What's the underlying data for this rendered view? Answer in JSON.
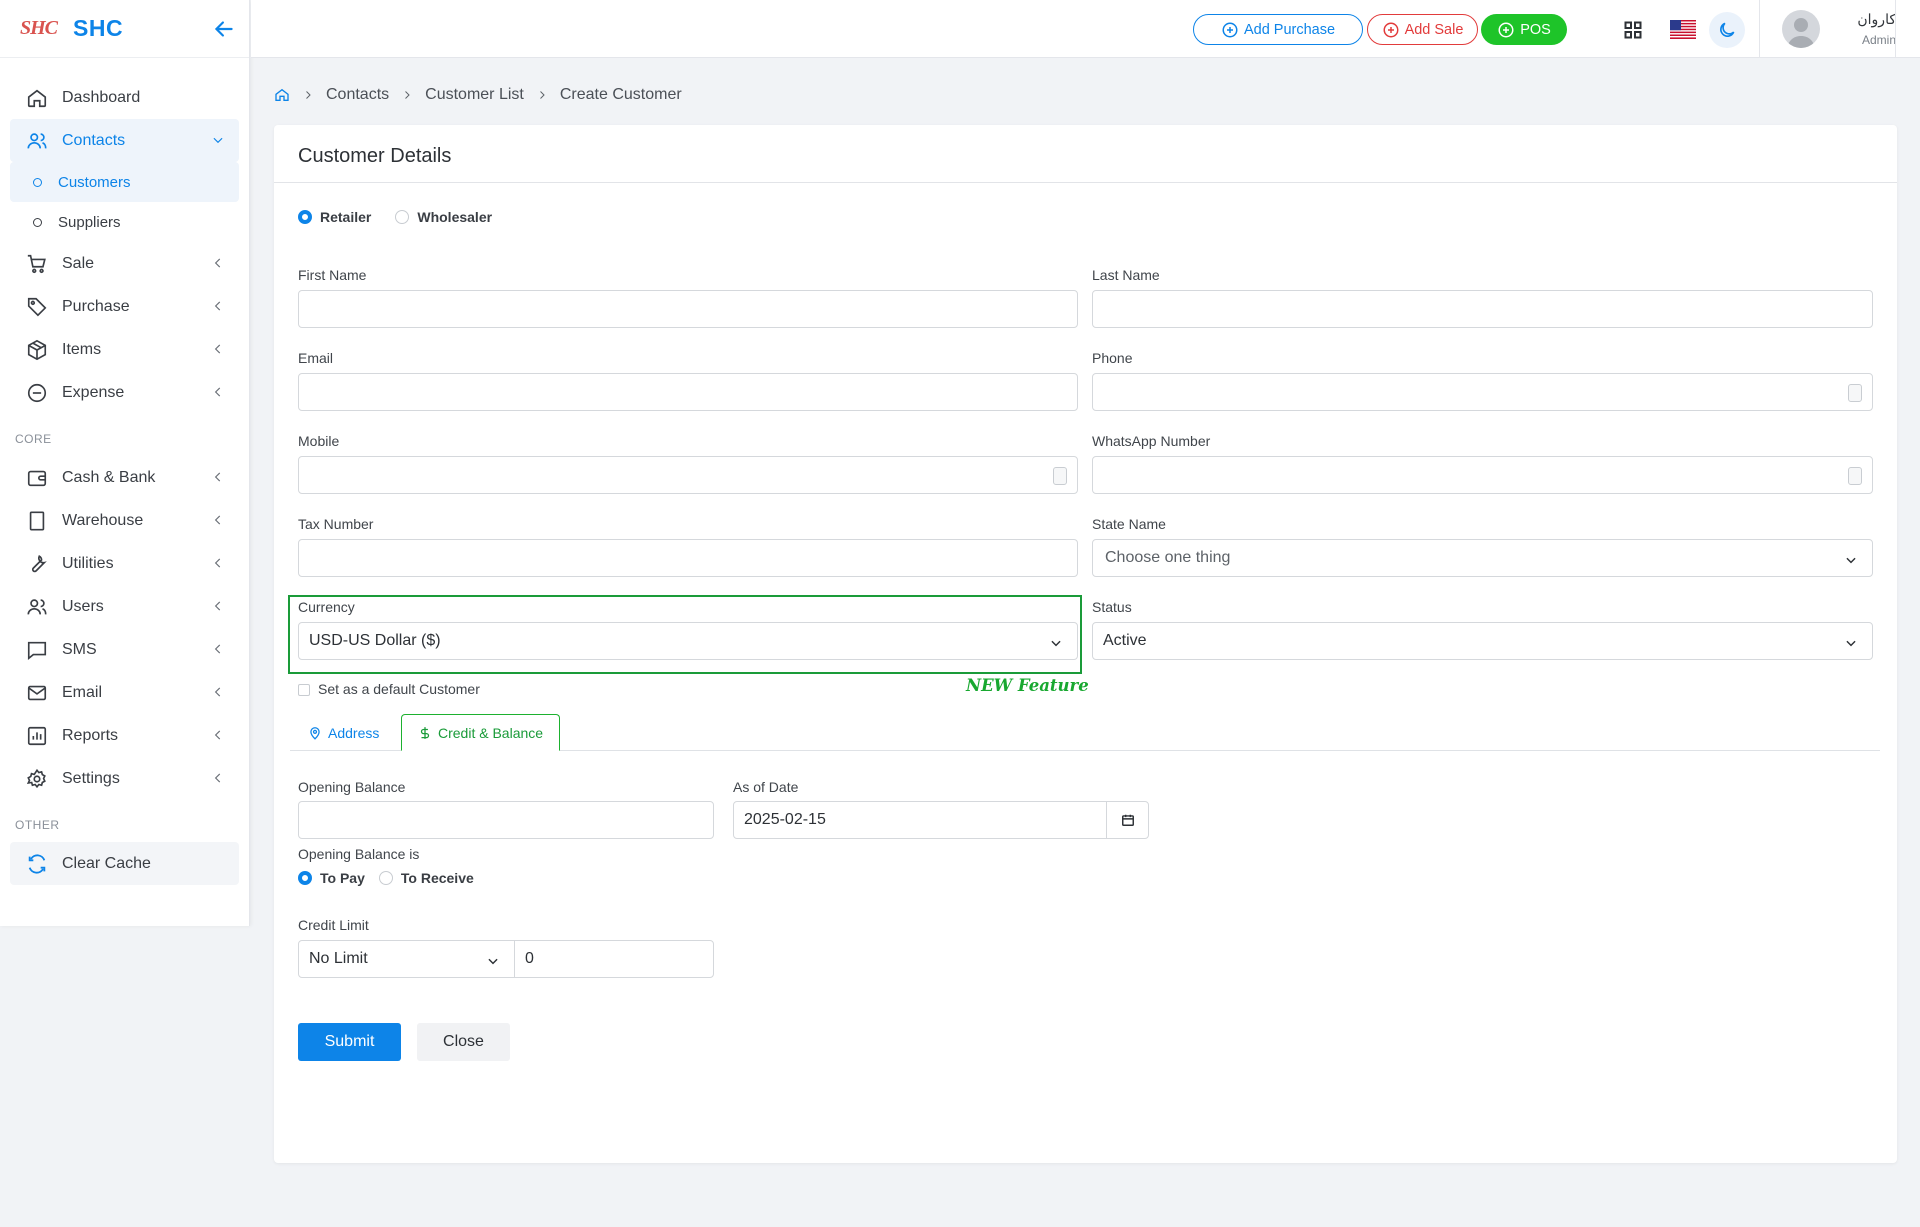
{
  "brand": {
    "logo": "SHC",
    "name": "SHC"
  },
  "sidebar": {
    "items": [
      {
        "label": "Dashboard"
      },
      {
        "label": "Contacts"
      },
      {
        "label": "Customers"
      },
      {
        "label": "Suppliers"
      },
      {
        "label": "Sale"
      },
      {
        "label": "Purchase"
      },
      {
        "label": "Items"
      },
      {
        "label": "Expense"
      },
      {
        "label": "Cash & Bank"
      },
      {
        "label": "Warehouse"
      },
      {
        "label": "Utilities"
      },
      {
        "label": "Users"
      },
      {
        "label": "SMS"
      },
      {
        "label": "Email"
      },
      {
        "label": "Reports"
      },
      {
        "label": "Settings"
      },
      {
        "label": "Clear Cache"
      }
    ],
    "sections": {
      "core": "CORE",
      "other": "OTHER"
    }
  },
  "topbar": {
    "add_purchase": "Add Purchase",
    "add_sale": "Add Sale",
    "pos": "POS",
    "user_name": "كاروان",
    "user_role": "Admin"
  },
  "breadcrumb": [
    "Contacts",
    "Customer List",
    "Create Customer"
  ],
  "form": {
    "title": "Customer Details",
    "customer_types": [
      "Retailer",
      "Wholesaler"
    ],
    "labels": {
      "first_name": "First Name",
      "last_name": "Last Name",
      "email": "Email",
      "phone": "Phone",
      "mobile": "Mobile",
      "whatsapp": "WhatsApp Number",
      "tax_number": "Tax Number",
      "state_name": "State Name",
      "currency": "Currency",
      "status": "Status"
    },
    "values": {
      "state_name": "Choose one thing",
      "currency": "USD-US Dollar ($)",
      "status": "Active"
    },
    "default_customer": "Set as a default Customer",
    "new_feature": "NEW Feature",
    "tabs": [
      "Address",
      "Credit & Balance"
    ],
    "credit": {
      "opening_balance": "Opening Balance",
      "as_of_date": "As of Date",
      "date_value": "2025-02-15",
      "opening_balance_is": "Opening Balance is",
      "to_pay": "To Pay",
      "to_receive": "To Receive",
      "credit_limit": "Credit Limit",
      "credit_limit_type": "No Limit",
      "credit_limit_value": "0"
    },
    "submit": "Submit",
    "close": "Close"
  },
  "colors": {
    "accent": "#0d84e8",
    "success": "#1ec429",
    "danger": "#e23b3b",
    "highlight": "#1a9b39"
  }
}
